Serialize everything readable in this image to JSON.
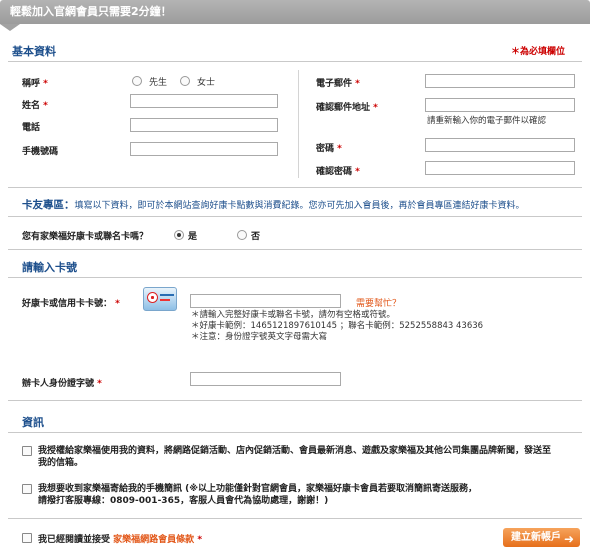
{
  "banner": {
    "text": "輕鬆加入官網會員只需要2分鐘！"
  },
  "basic": {
    "title": "基本資料",
    "required_note": "＊為必填欄位",
    "title_label": "稱呼",
    "title_options": [
      "先生",
      "女士"
    ],
    "name_label": "姓名",
    "phone_label": "電話",
    "mobile_label": "手機號碼",
    "email_label": "電子郵件",
    "email_confirm_label": "確認郵件地址",
    "email_confirm_hint": "請重新輸入你的電子郵件以確認",
    "password_label": "密碼",
    "password_confirm_label": "確認密碼"
  },
  "card_zone": {
    "title": "卡友專區：",
    "desc": "填寫以下資料，即可於本網站查詢好康卡點數與消費紀錄。您亦可先加入會員後，再於會員專區連結好康卡資料。",
    "question": "您有家樂福好康卡或聯名卡嗎？",
    "options": [
      "是",
      "否"
    ],
    "selected": "是"
  },
  "card_entry": {
    "title": "請輸入卡號",
    "card_label": "好康卡或信用卡卡號：",
    "help_link": "需要幫忙？",
    "hints": [
      "＊請輸入完整好康卡或聯名卡號，請勿有空格或符號。",
      "＊好康卡範例：1465121897610145 ；聯名卡範例：5252558843 43636",
      "＊注意：身份證字號英文字母需大寫"
    ],
    "id_label": "辦卡人身份證字號"
  },
  "info": {
    "title": "資訊",
    "opt1_line1": "我授權給家樂福使用我的資料，將網路促銷活動、店內促銷活動、會員最新消息、遊戲及家樂福及其他公司集團品牌新聞，發送至",
    "opt1_line2": "我的信箱。",
    "opt2_line1": "我想要收到家樂福寄給我的手機簡訊 (※以上功能僅針對官網會員，家樂福好康卡會員若要取消簡訊寄送服務，",
    "opt2_line2": "請撥打客服專線：0809-001-365，客服人員會代為協助處理，謝謝！)",
    "terms_prefix": "我已經閱讀並接受",
    "terms_link": "家樂福網路會員條款",
    "submit_label": "建立新帳戶",
    "submit_arrow": "➜"
  }
}
